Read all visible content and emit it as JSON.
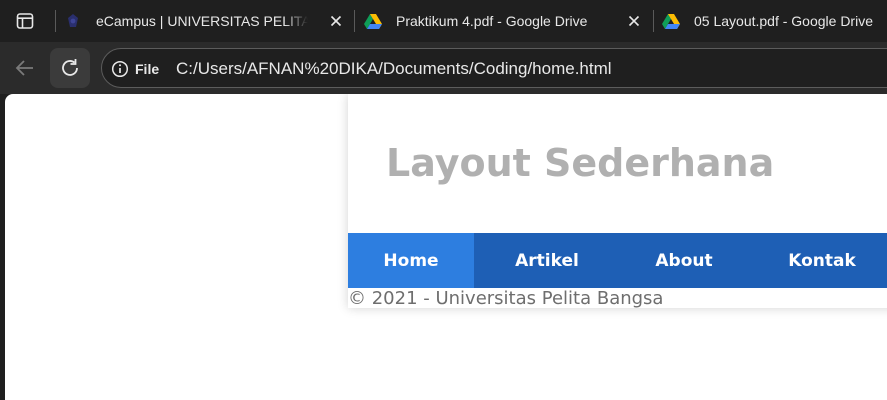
{
  "browser": {
    "tabs": [
      {
        "title": "eCampus | UNIVERSITAS PELITA BANGSA",
        "icon": "campus-favicon-icon"
      },
      {
        "title": "Praktikum 4.pdf - Google Drive",
        "icon": "google-drive-icon"
      },
      {
        "title": "05 Layout.pdf - Google Drive",
        "icon": "google-drive-icon"
      }
    ],
    "site_info_label": "File",
    "url": "C:/Users/AFNAN%20DIKA/Documents/Coding/home.html"
  },
  "page": {
    "title": "Layout Sederhana",
    "nav": [
      {
        "label": "Home",
        "active": true
      },
      {
        "label": "Artikel",
        "active": false
      },
      {
        "label": "About",
        "active": false
      },
      {
        "label": "Kontak",
        "active": false
      }
    ],
    "footer": "© 2021 - Universitas Pelita Bangsa"
  },
  "colors": {
    "nav_background": "#1e5fb5",
    "nav_active": "#2d7ee0",
    "title_color": "#b0b0b0",
    "footer_color": "#6e6e6e"
  }
}
